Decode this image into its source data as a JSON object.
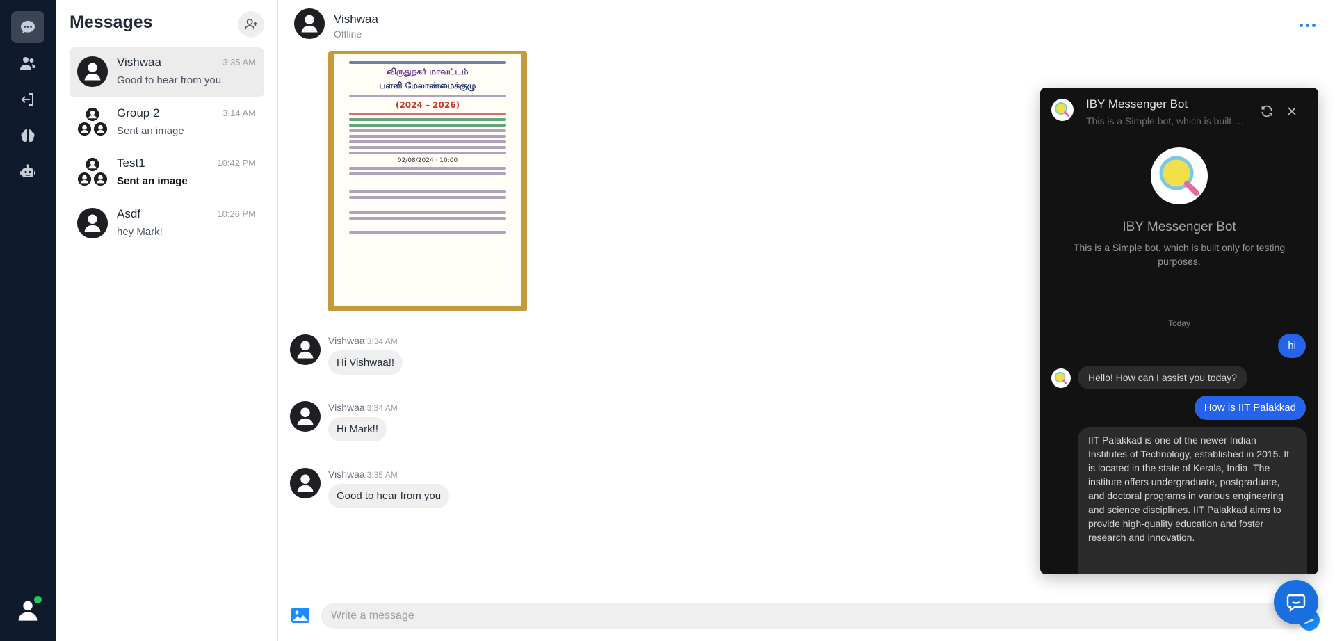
{
  "sidebar": {
    "nav": [
      {
        "icon": "chat-icon",
        "active": true
      },
      {
        "icon": "contacts-icon",
        "active": false
      },
      {
        "icon": "logout-icon",
        "active": false
      },
      {
        "icon": "brain-icon",
        "active": false
      },
      {
        "icon": "robot-icon",
        "active": false
      }
    ],
    "profile": {
      "icon": "user-profile-icon",
      "online": true
    }
  },
  "list": {
    "title": "Messages",
    "conversations": [
      {
        "name": "Vishwaa",
        "time": "3:35 AM",
        "last": "Good to hear from you",
        "type": "user",
        "active": true,
        "unread": false
      },
      {
        "name": "Group 2",
        "time": "3:14 AM",
        "last": "Sent an image",
        "type": "group",
        "active": false,
        "unread": false
      },
      {
        "name": "Test1",
        "time": "10:42 PM",
        "last": "Sent an image",
        "type": "group",
        "active": false,
        "unread": true
      },
      {
        "name": "Asdf",
        "time": "10:26 PM",
        "last": "hey Mark!",
        "type": "user",
        "active": false,
        "unread": false
      }
    ]
  },
  "chat": {
    "name": "Vishwaa",
    "status": "Offline",
    "image_text": {
      "line1": "விருதுநகர் மாவட்டம்",
      "line2": "பள்ளி மேலாண்மைக்குழு",
      "line3": "(2024 – 2026)",
      "date": "02/08/2024",
      "time": "10:00"
    },
    "messages": [
      {
        "sender": "Vishwaa",
        "time": "3:34 AM",
        "text": "Hi Vishwaa!!"
      },
      {
        "sender": "Vishwaa",
        "time": "3:34 AM",
        "text": "Hi Mark!!"
      },
      {
        "sender": "Vishwaa",
        "time": "3:35 AM",
        "text": "Good to hear from you"
      }
    ],
    "composer": {
      "placeholder": "Write a message"
    }
  },
  "bot": {
    "title": "IBY Messenger Bot",
    "subtitle": "This is a Simple bot, which is built only for testing purposes.",
    "day": "Today",
    "messages": [
      {
        "from": "user",
        "text": "hi"
      },
      {
        "from": "bot",
        "text": "Hello! How can I assist you today?"
      },
      {
        "from": "user",
        "text": "How is IIT Palakkad"
      },
      {
        "from": "bot",
        "text": "IIT Palakkad is one of the newer Indian Institutes of Technology, established in 2015. It is located in the state of Kerala, India. The institute offers undergraduate, postgraduate, and doctoral programs in various engineering and science disciplines. IIT Palakkad aims to provide high-quality education and foster research and innovation."
      }
    ]
  },
  "colors": {
    "accent": "#1a8cff",
    "rail": "#0f1b2d",
    "bot_bg": "#121212",
    "user_bubble": "#2563eb",
    "online": "#22c55e"
  }
}
